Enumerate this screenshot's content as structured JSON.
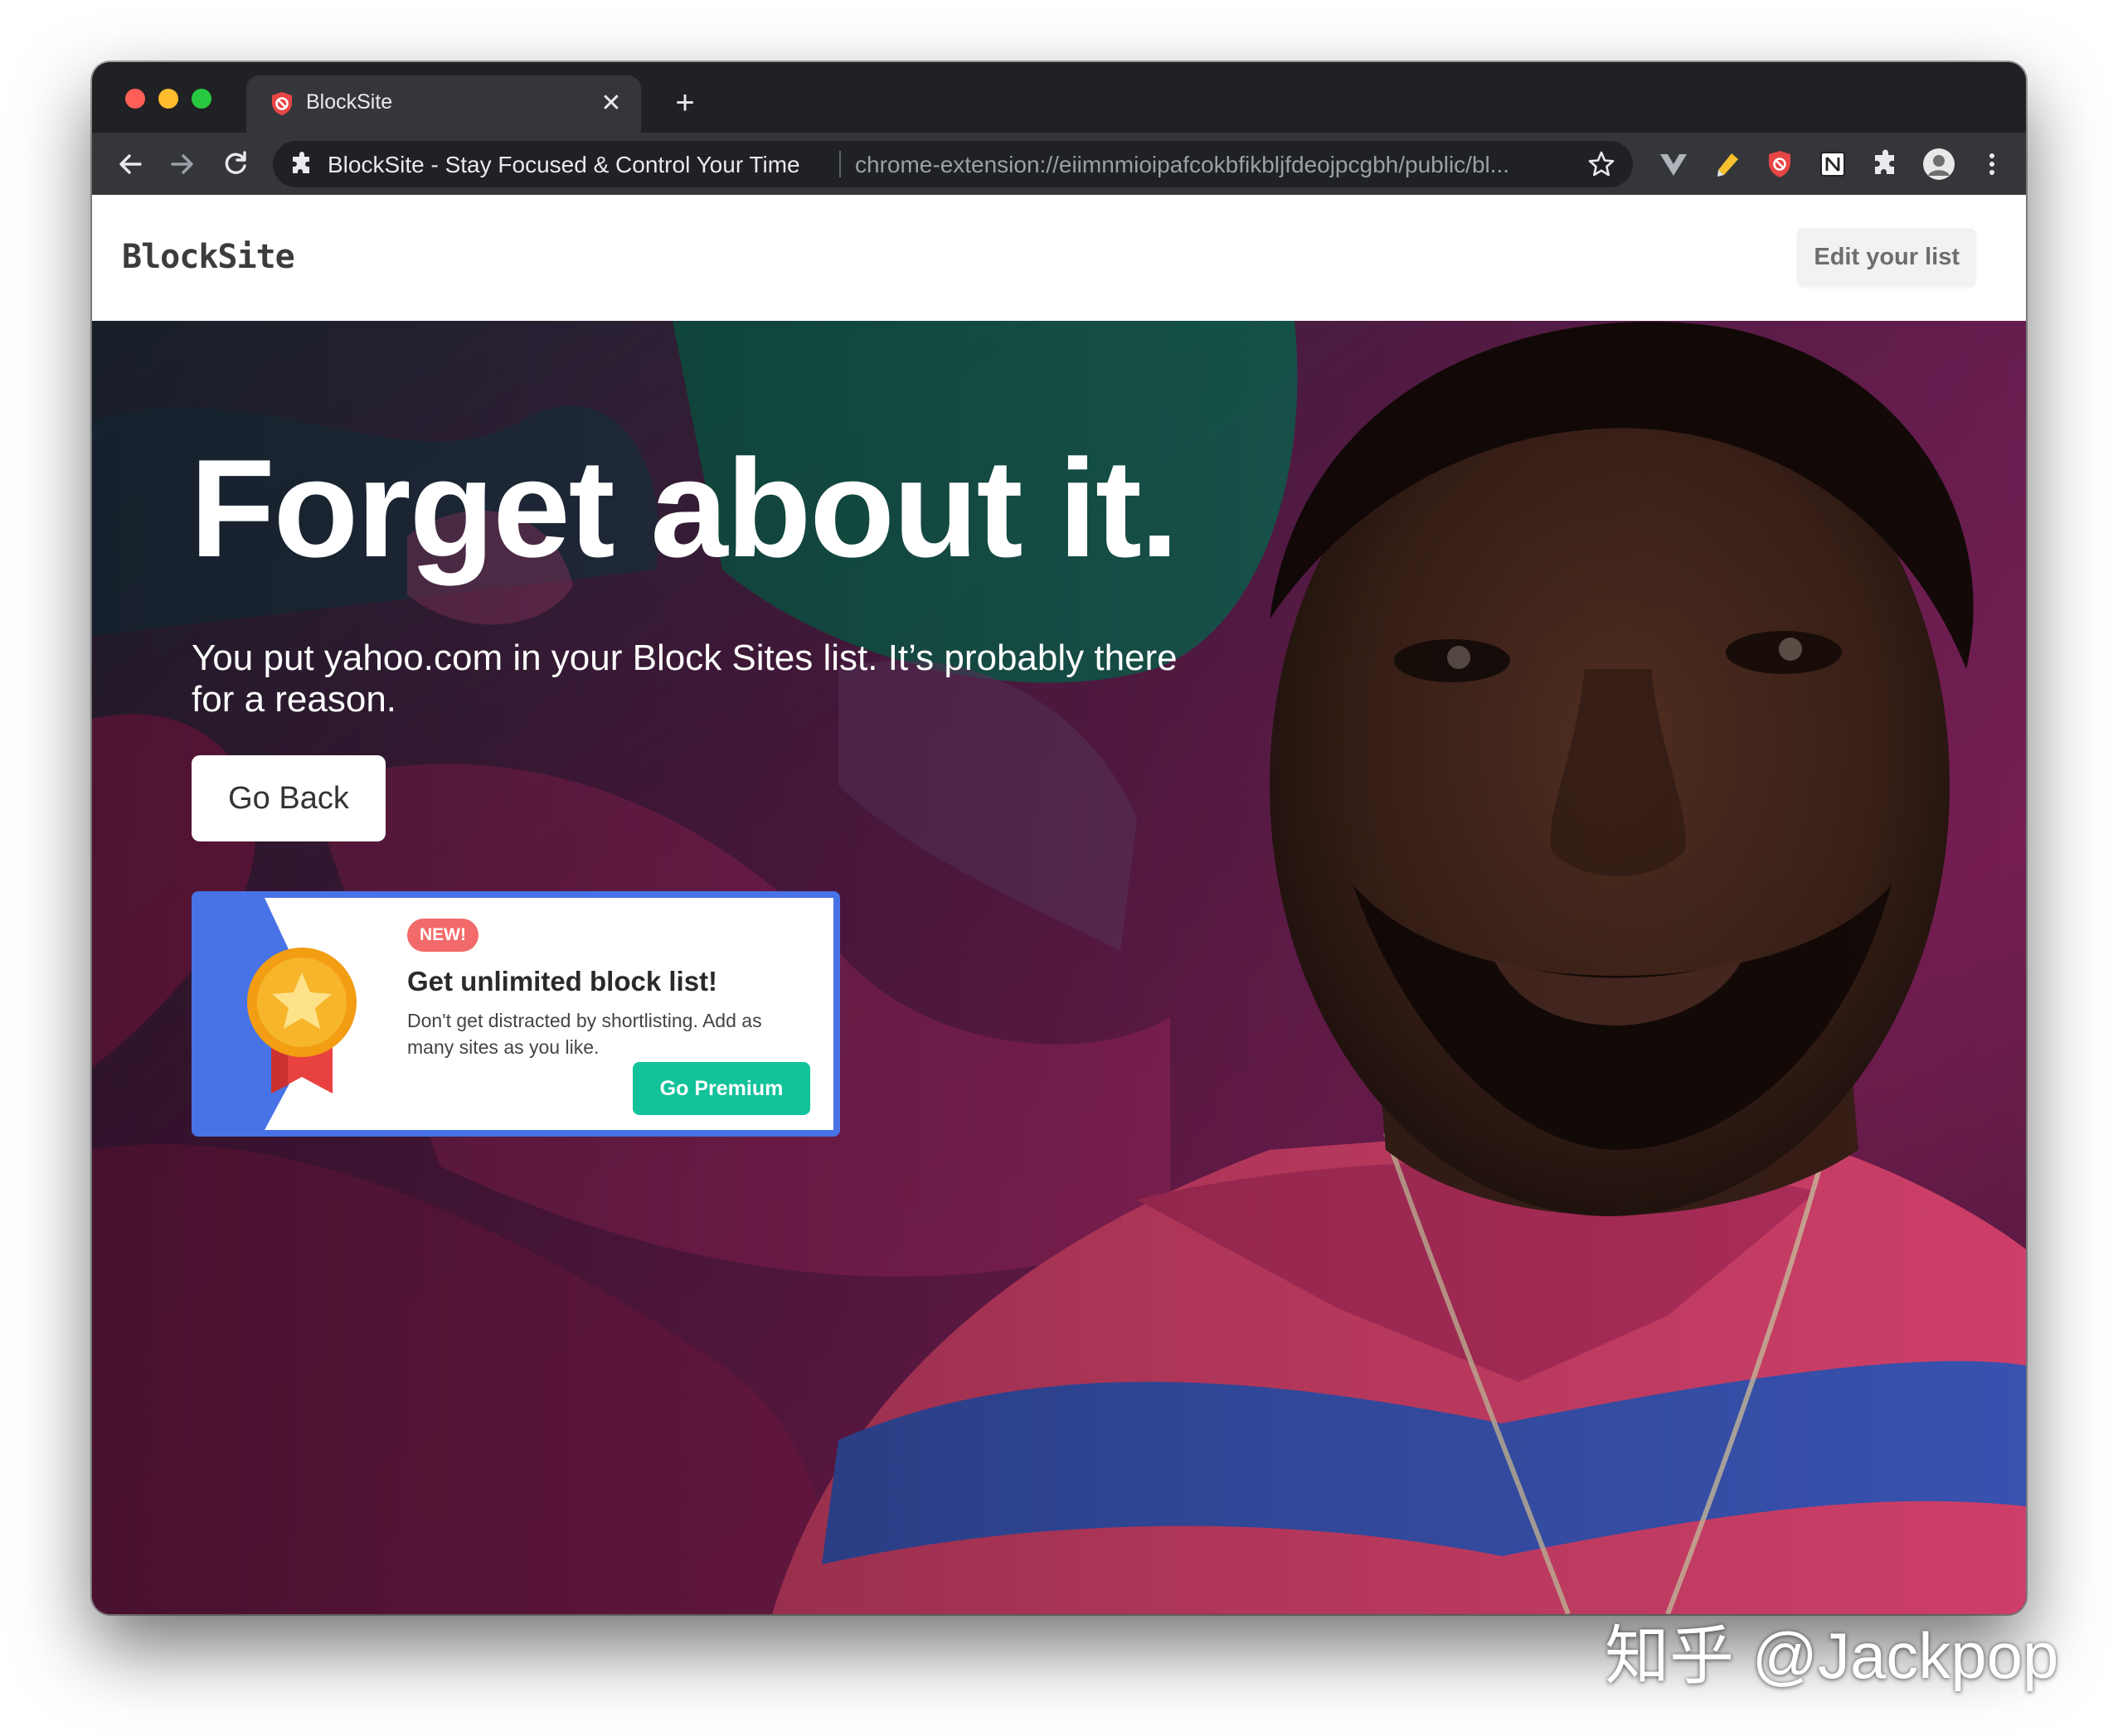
{
  "browser": {
    "tab": {
      "title": "BlockSite",
      "close_icon": "close-icon"
    },
    "new_tab_icon": "plus-icon",
    "omnibox": {
      "site_name": "BlockSite - Stay Focused & Control Your Time",
      "url": "chrome-extension://eiimnmioipafcokbfikbljfdeojpcgbh/public/bl...",
      "extension_icon": "puzzle-icon",
      "bookmark_icon": "star-icon"
    },
    "extensions": [
      "vue-devtools-icon",
      "highlighter-icon",
      "blocksite-shield-icon",
      "notion-icon",
      "extensions-puzzle-icon",
      "profile-avatar",
      "more-menu-icon"
    ],
    "colors": {
      "frame": "#202124",
      "toolbar": "#35363a",
      "close": "#ff5f57",
      "minimize": "#febc2e",
      "maximize": "#28c840"
    }
  },
  "header": {
    "logo": "BlockSite",
    "edit_button": "Edit your list"
  },
  "hero": {
    "title": "Forget about it.",
    "subtitle": "You put yahoo.com in your Block Sites list. It’s probably there for a reason.",
    "go_back": "Go Back"
  },
  "promo": {
    "badge": "NEW!",
    "title": "Get unlimited block list!",
    "description": "Don't get distracted by shortlisting. Add as many sites as you like.",
    "cta": "Go Premium",
    "colors": {
      "border": "#4873e6",
      "badge": "#f36a6a",
      "cta": "#12c29a",
      "medal": "#f7b52b",
      "ribbon": "#e8413f"
    }
  },
  "watermark": "知乎 @Jackpop"
}
